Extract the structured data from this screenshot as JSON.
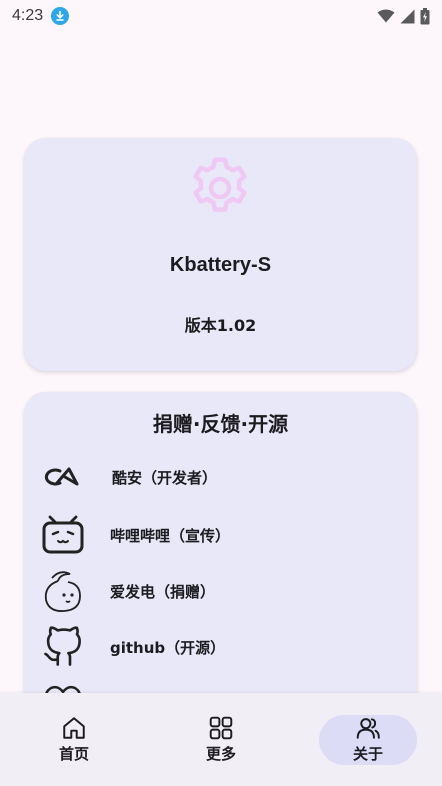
{
  "status_bar": {
    "time": "4:23",
    "icons": [
      "download-icon",
      "wifi-icon",
      "signal-icon",
      "battery-charging-icon"
    ]
  },
  "about_card": {
    "icon": "gear-icon",
    "icon_color": "#f0c8f4",
    "app_name": "Kbattery-S",
    "version": "版本1.02"
  },
  "links_card": {
    "title": "捐赠·反馈·开源",
    "items": [
      {
        "label": "酷安（开发者）",
        "icon": "coolapk-icon"
      },
      {
        "label": "哔哩哔哩（宣传）",
        "icon": "bilibili-icon"
      },
      {
        "label": "爱发电（捐赠）",
        "icon": "afdian-icon"
      },
      {
        "label": "github（开源）",
        "icon": "github-icon"
      },
      {
        "label": "",
        "icon": "heart-icon"
      }
    ]
  },
  "bottom_nav": {
    "items": [
      {
        "label": "首页",
        "icon": "home-icon",
        "active": false
      },
      {
        "label": "更多",
        "icon": "grid-icon",
        "active": false
      },
      {
        "label": "关于",
        "icon": "people-icon",
        "active": true
      }
    ]
  },
  "colors": {
    "background": "#fdf7fc",
    "card": "#e8e8f8",
    "active_pill": "#dcdcf6",
    "nav_background": "#f2eef5"
  }
}
